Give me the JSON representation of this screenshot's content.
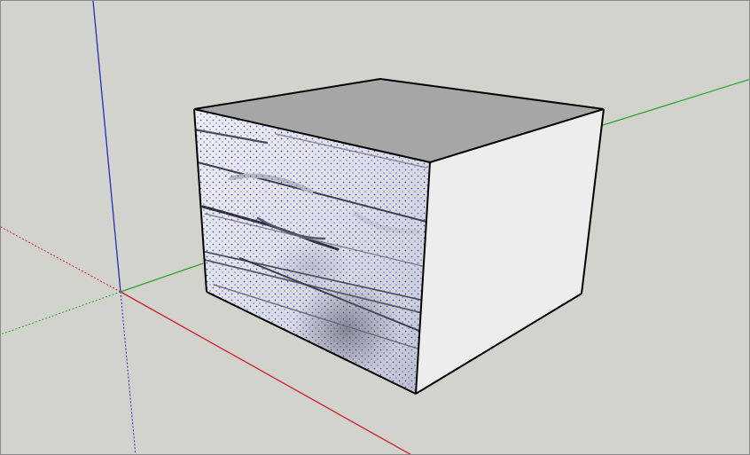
{
  "viewport": {
    "background_color": "#d3d3ce",
    "border_color": "#8a8a8a"
  },
  "axes": {
    "red_color": "#d0202a",
    "green_color": "#2aa52a",
    "blue_color": "#2a2ab8"
  },
  "model": {
    "type": "box",
    "top_face_color": "#a6a6a6",
    "right_face_color": "#ededed",
    "front_face_material": "marble-texture",
    "edge_color": "#000000"
  }
}
